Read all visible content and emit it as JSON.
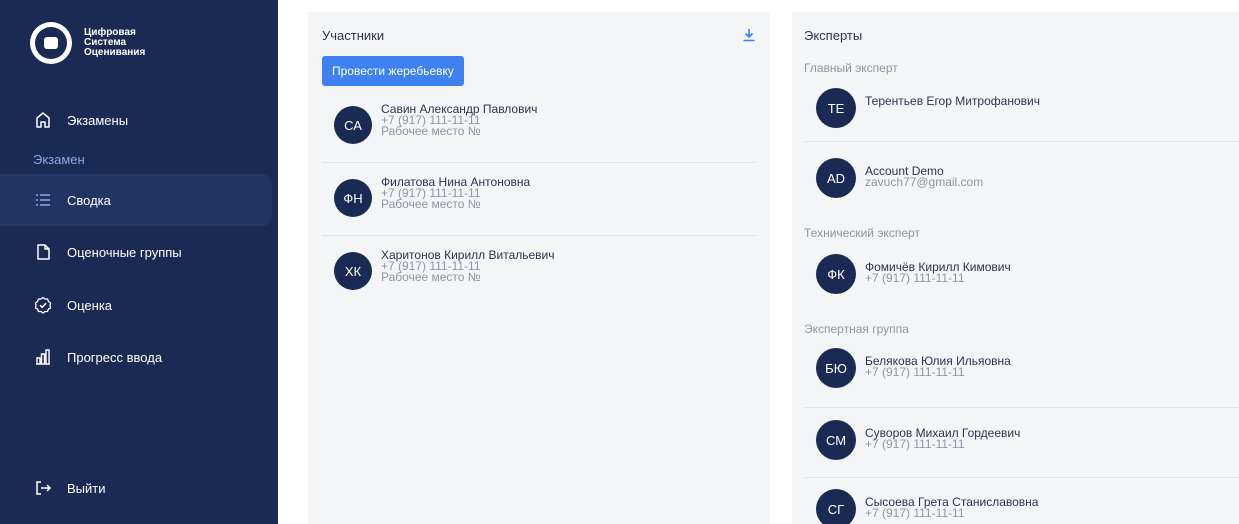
{
  "sidebar": {
    "logo_lines": [
      "Цифровая",
      "Система",
      "Оценивания"
    ],
    "exams_label": "Экзамены",
    "section_label": "Экзамен",
    "items": [
      {
        "label": "Сводка",
        "icon": "list-icon"
      },
      {
        "label": "Оценочные группы",
        "icon": "document-icon"
      },
      {
        "label": "Оценка",
        "icon": "badge-check-icon"
      },
      {
        "label": "Прогресс ввода",
        "icon": "bar-chart-icon"
      }
    ],
    "logout_label": "Выйти"
  },
  "participants": {
    "title": "Участники",
    "draw_button": "Провести жеребьевку",
    "list": [
      {
        "initials": "СА",
        "name": "Савин Александр Павлович",
        "phone": "+7 (917) 111-11-11",
        "workplace": "Рабочее место №"
      },
      {
        "initials": "ФН",
        "name": "Филатова Нина Антоновна",
        "phone": "+7 (917) 111-11-11",
        "workplace": "Рабочее место №"
      },
      {
        "initials": "ХК",
        "name": "Харитонов Кирилл Витальевич",
        "phone": "+7 (917) 111-11-11",
        "workplace": "Рабочее место №"
      }
    ]
  },
  "experts": {
    "title": "Эксперты",
    "chief_label": "Главный эксперт",
    "chief": [
      {
        "initials": "ТЕ",
        "name": "Терентьев Егор Митрофанович",
        "sub": "+7 (917) 111-11-11"
      },
      {
        "initials": "AD",
        "name": "Account Demo",
        "sub": "zavuch77@gmail.com"
      }
    ],
    "tech_label": "Технический эксперт",
    "tech": [
      {
        "initials": "ФК",
        "name": "Фомичёв Кирилл Кимович",
        "sub": "+7 (917) 111-11-11"
      }
    ],
    "group_label": "Экспертная группа",
    "group": [
      {
        "initials": "БЮ",
        "name": "Белякова Юлия Ильяовна",
        "sub": "+7 (917) 111-11-11"
      },
      {
        "initials": "СМ",
        "name": "Суворов Михаил Гордеевич",
        "sub": "+7 (917) 111-11-11"
      },
      {
        "initials": "СГ",
        "name": "Сысоева Грета Станиславовна",
        "sub": "+7 (917) 111-11-11"
      }
    ]
  }
}
